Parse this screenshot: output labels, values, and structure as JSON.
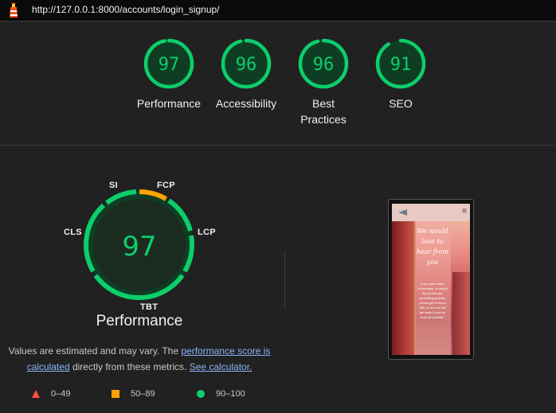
{
  "url": "http://127.0.0.1:8000/accounts/login_signup/",
  "colors": {
    "good": "#0cce6b",
    "average": "#ffa400",
    "poor": "#ff4e42",
    "good_bg": "#0f3d24"
  },
  "categories": [
    {
      "score": "97",
      "label": "Performance"
    },
    {
      "score": "96",
      "label": "Accessibility"
    },
    {
      "score": "96",
      "label": "Best Practices"
    },
    {
      "score": "91",
      "label": "SEO"
    }
  ],
  "performance": {
    "score": "97",
    "title": "Performance",
    "metrics": {
      "si": "SI",
      "fcp": "FCP",
      "lcp": "LCP",
      "tbt": "TBT",
      "cls": "CLS"
    },
    "note": {
      "prefix": "Values are estimated and may vary. The",
      "link1": "performance score is calculated",
      "middle": "directly from these metrics.",
      "link2": "See calculator."
    }
  },
  "legend": {
    "poor": "0–49",
    "average": "50–89",
    "good": "90–100"
  },
  "preview": {
    "heading": "We would love to hear from you",
    "body": "If you want more information, or would like to discuss something specific, please get in touch with us and we will get back to you as soon as possible.",
    "menu_icon": "≡"
  }
}
